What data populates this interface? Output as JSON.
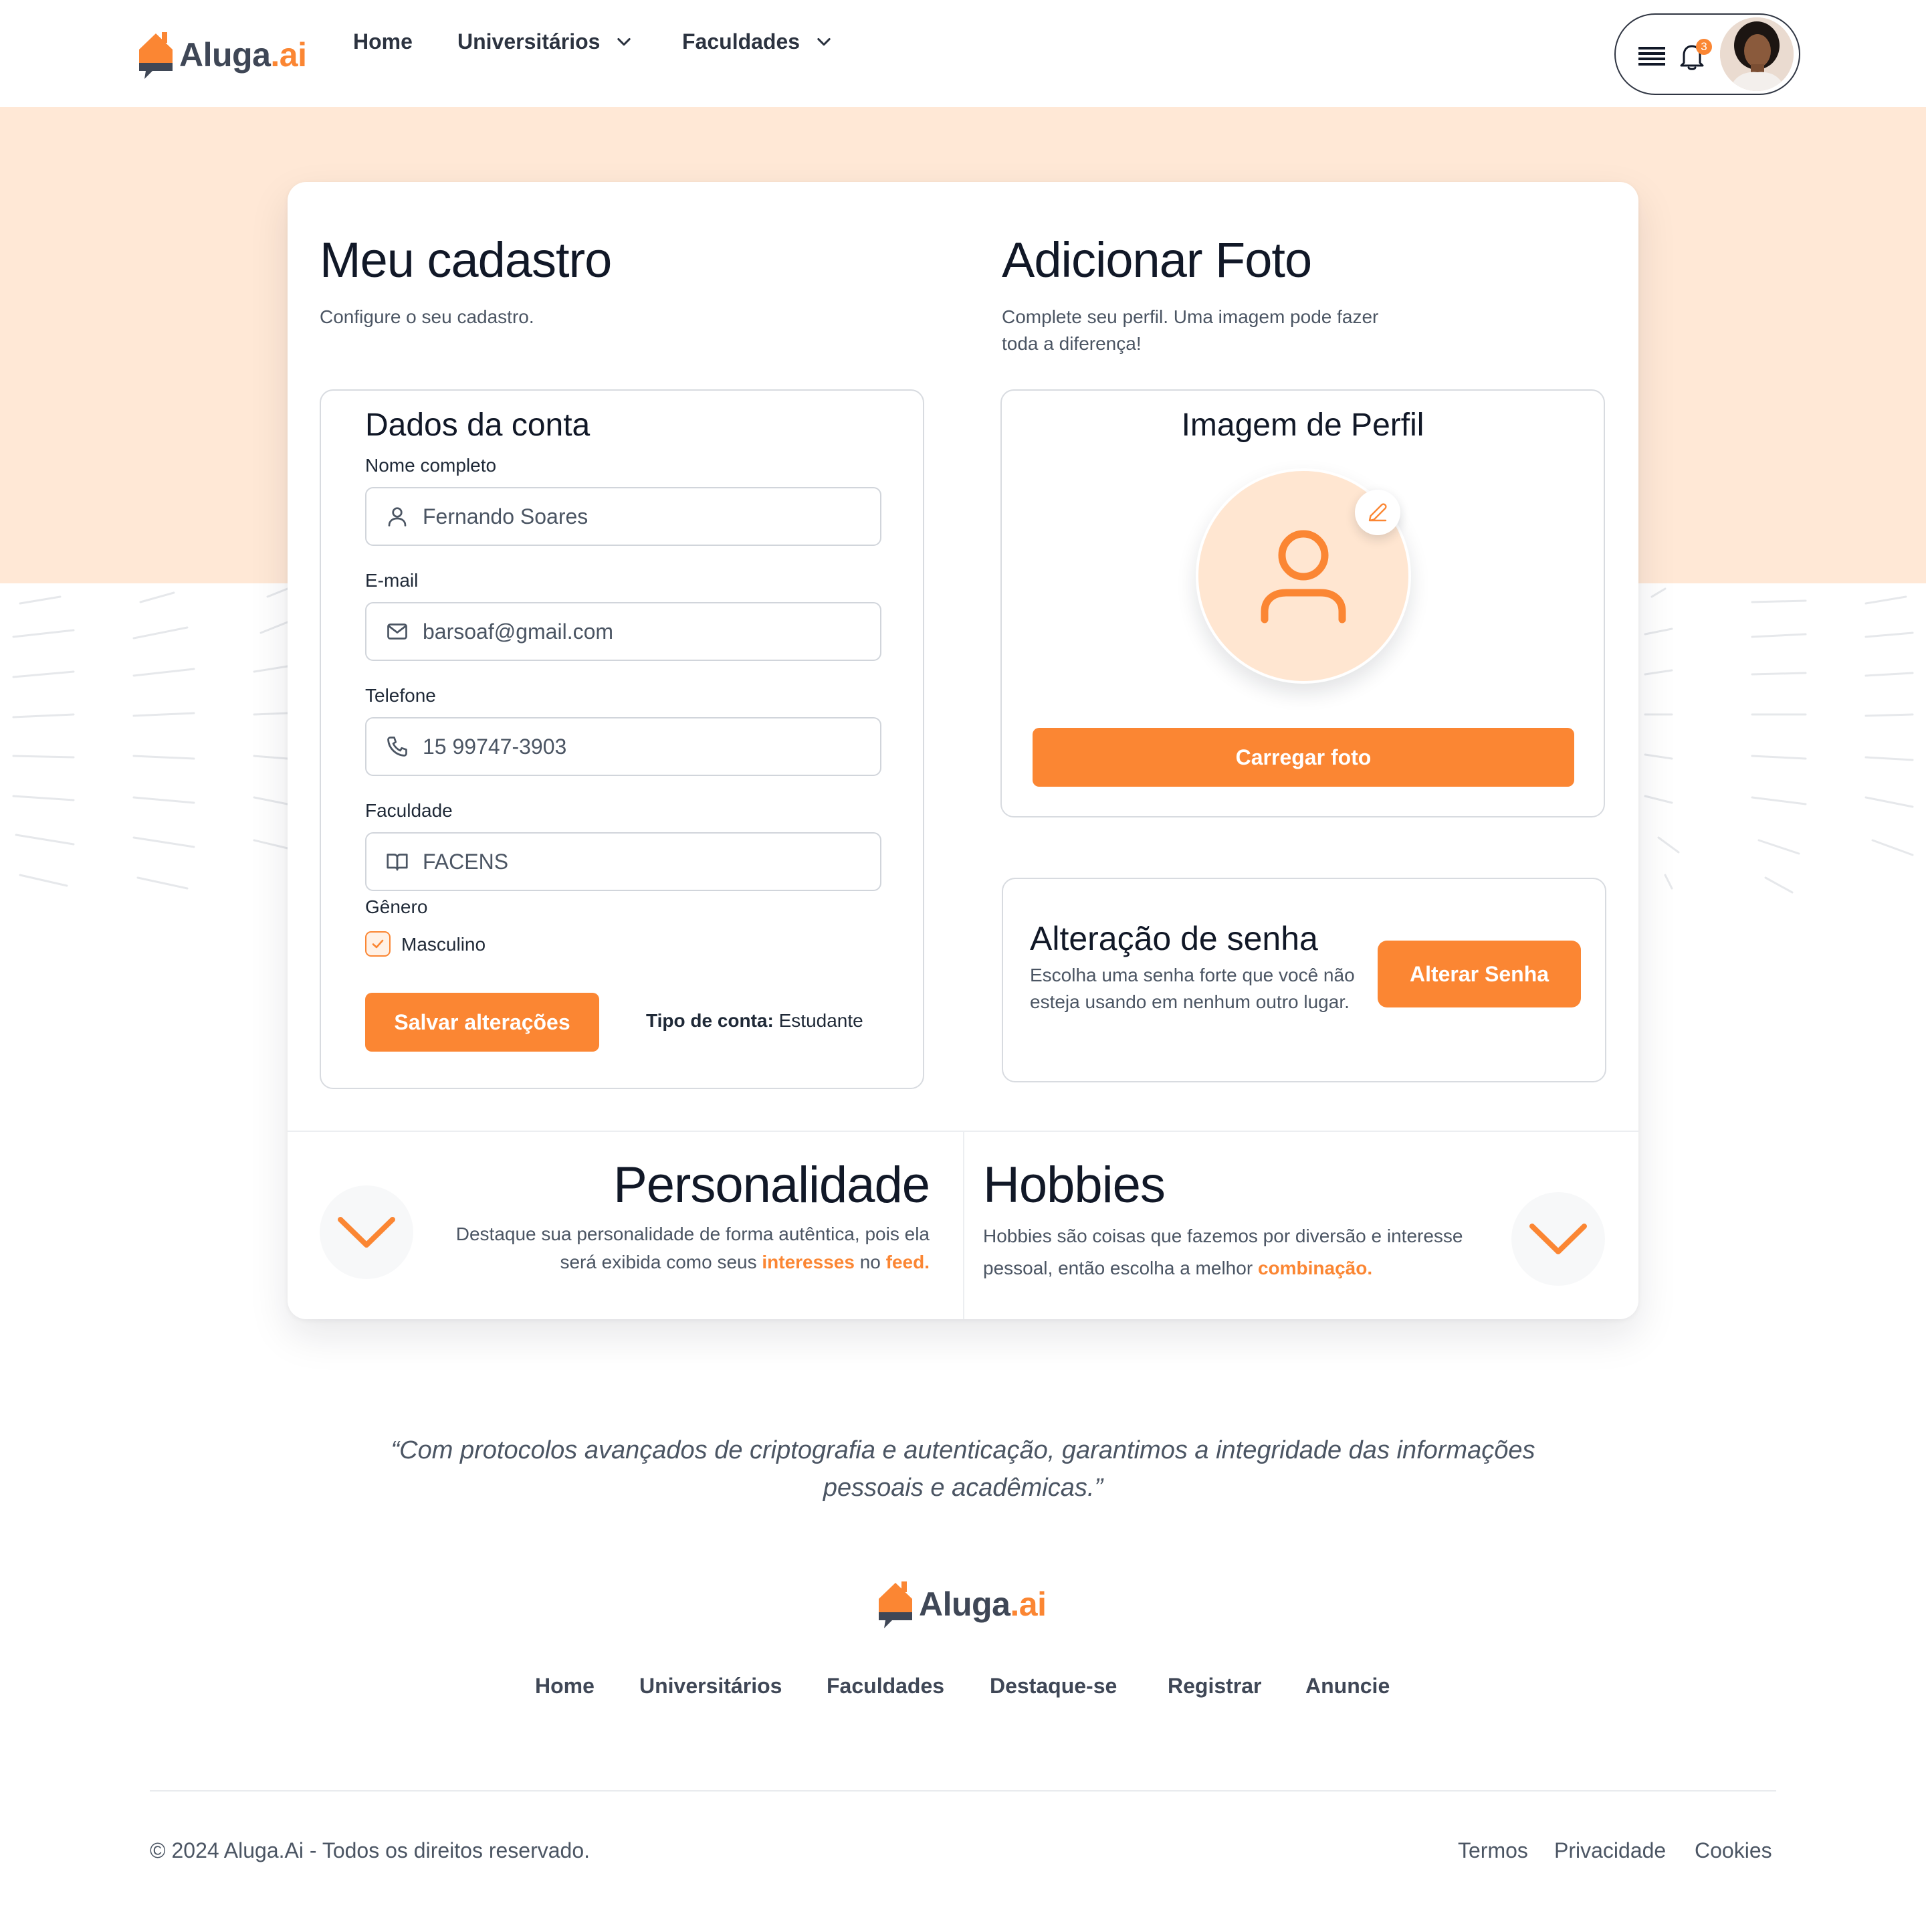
{
  "header": {
    "logo_text": "Aluga",
    "logo_suffix": ".ai",
    "nav": [
      {
        "label": "Home"
      },
      {
        "label": "Universitários"
      },
      {
        "label": "Faculdades"
      }
    ],
    "notification_count": "3"
  },
  "account": {
    "title": "Meu cadastro",
    "subtitle": "Configure o seu cadastro.",
    "panel_title": "Dados da conta",
    "fields": {
      "name": {
        "label": "Nome completo",
        "value": "Fernando Soares",
        "icon": "user-icon"
      },
      "email": {
        "label": "E-mail",
        "value": "barsoaf@gmail.com",
        "icon": "mail-icon"
      },
      "phone": {
        "label": "Telefone",
        "value": "15 99747-3903",
        "icon": "phone-icon"
      },
      "college": {
        "label": "Faculdade",
        "value": "FACENS",
        "icon": "book-icon"
      }
    },
    "gender_label": "Gênero",
    "gender_option": "Masculino",
    "gender_checked": true,
    "save_button": "Salvar alterações",
    "account_type_label": "Tipo de conta:",
    "account_type_value": "Estudante"
  },
  "photo": {
    "title": "Adicionar Foto",
    "subtitle": "Complete seu perfil. Uma imagem pode fazer toda a diferença!",
    "panel_title": "Imagem de Perfil",
    "upload_button": "Carregar foto"
  },
  "password": {
    "title": "Alteração de senha",
    "text": "Escolha uma senha forte que você não esteja usando em nenhum outro lugar.",
    "button": "Alterar Senha"
  },
  "personality": {
    "title": "Personalidade",
    "text_a": "Destaque sua personalidade de forma autêntica, pois ela será exibida como seus",
    "hl_1": "interesses",
    "text_b": "no",
    "hl_2": "feed."
  },
  "hobbies": {
    "title": "Hobbies",
    "text_a": "Hobbies são coisas que fazemos por diversão e interesse pessoal, então escolha a melhor",
    "hl_1": "combinação."
  },
  "quote": "“Com protocolos avançados de criptografia e autenticação, garantimos a integridade das informações pessoais e acadêmicas.”",
  "footer": {
    "links": [
      "Home",
      "Universitários",
      "Faculdades",
      "Destaque-se",
      "Registrar",
      "Anuncie"
    ],
    "copyright": "© 2024 Aluga.Ai - Todos os direitos reservado.",
    "legal": [
      "Termos",
      "Privacidade",
      "Cookies"
    ]
  },
  "colors": {
    "accent": "#fb8633",
    "hero": "#ffe8d6",
    "text": "#111827"
  }
}
